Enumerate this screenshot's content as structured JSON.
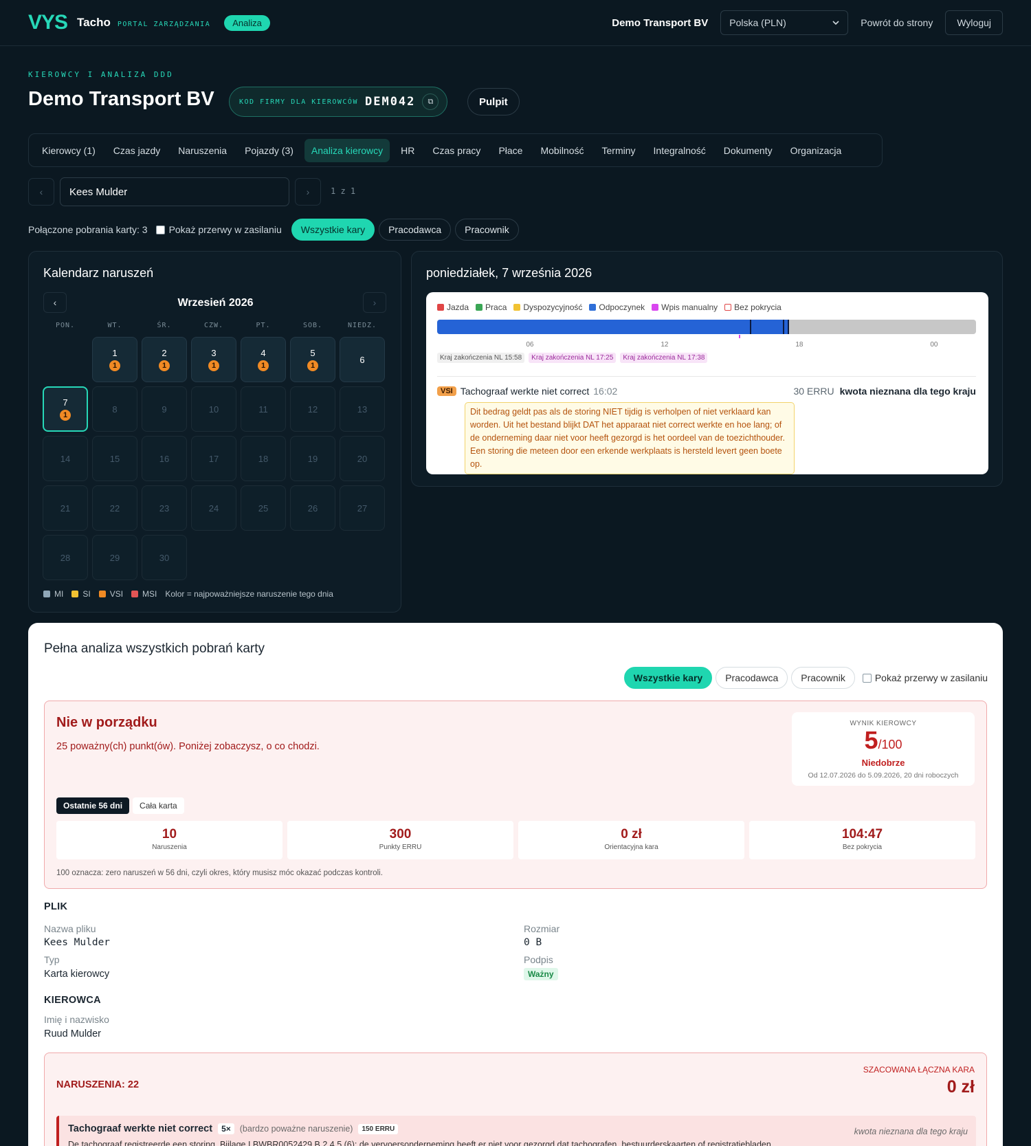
{
  "topbar": {
    "logo_mark": "VYS",
    "logo_name": "Tacho",
    "logo_sub": "PORTAL ZARZĄDZANIA",
    "badge": "Analiza",
    "company": "Demo Transport BV",
    "country_select": "Polska (PLN)",
    "back_link": "Powrót do strony",
    "logout": "Wyloguj"
  },
  "header": {
    "eyebrow": "KIEROWCY I ANALIZA DDD",
    "title": "Demo Transport BV",
    "code_label": "KOD FIRMY DLA KIEROWCÓW",
    "code_value": "DEM042",
    "pulpit": "Pulpit"
  },
  "tabs": [
    "Kierowcy (1)",
    "Czas jazdy",
    "Naruszenia",
    "Pojazdy (3)",
    "Analiza kierowcy",
    "HR",
    "Czas pracy",
    "Płace",
    "Mobilność",
    "Terminy",
    "Integralność",
    "Dokumenty",
    "Organizacja"
  ],
  "active_tab": "Analiza kierowcy",
  "driver": {
    "name": "Kees Mulder",
    "pager": "1 z 1",
    "prev": "‹",
    "next": "›"
  },
  "filters": {
    "downloads": "Połączone pobrania karty: 3",
    "power_breaks": "Pokaż przerwy w zasilaniu",
    "chips": [
      "Wszystkie kary",
      "Pracodawca",
      "Pracownik"
    ],
    "active_chip": "Wszystkie kary"
  },
  "calendar": {
    "title": "Kalendarz naruszeń",
    "month": "Wrzesień 2026",
    "weekdays": [
      "PON.",
      "WT.",
      "ŚR.",
      "CZW.",
      "PT.",
      "SOB.",
      "NIEDZ."
    ],
    "days": [
      {
        "d": "",
        "state": "empty"
      },
      {
        "d": "1",
        "state": "cur",
        "badge": "1"
      },
      {
        "d": "2",
        "state": "cur",
        "badge": "1"
      },
      {
        "d": "3",
        "state": "cur",
        "badge": "1"
      },
      {
        "d": "4",
        "state": "cur",
        "badge": "1"
      },
      {
        "d": "5",
        "state": "cur",
        "badge": "1"
      },
      {
        "d": "6",
        "state": "cur"
      },
      {
        "d": "7",
        "state": "sel",
        "badge": "1"
      },
      {
        "d": "8",
        "state": "fut"
      },
      {
        "d": "9",
        "state": "fut"
      },
      {
        "d": "10",
        "state": "fut"
      },
      {
        "d": "11",
        "state": "fut"
      },
      {
        "d": "12",
        "state": "fut"
      },
      {
        "d": "13",
        "state": "fut"
      },
      {
        "d": "14",
        "state": "fut"
      },
      {
        "d": "15",
        "state": "fut"
      },
      {
        "d": "16",
        "state": "fut"
      },
      {
        "d": "17",
        "state": "fut"
      },
      {
        "d": "18",
        "state": "fut"
      },
      {
        "d": "19",
        "state": "fut"
      },
      {
        "d": "20",
        "state": "fut"
      },
      {
        "d": "21",
        "state": "fut"
      },
      {
        "d": "22",
        "state": "fut"
      },
      {
        "d": "23",
        "state": "fut"
      },
      {
        "d": "24",
        "state": "fut"
      },
      {
        "d": "25",
        "state": "fut"
      },
      {
        "d": "26",
        "state": "fut"
      },
      {
        "d": "27",
        "state": "fut"
      },
      {
        "d": "28",
        "state": "fut"
      },
      {
        "d": "29",
        "state": "fut"
      },
      {
        "d": "30",
        "state": "fut"
      }
    ],
    "legend": [
      {
        "label": "MI",
        "color": "#8fa7b8"
      },
      {
        "label": "SI",
        "color": "#f1c232"
      },
      {
        "label": "VSI",
        "color": "#f08a24"
      },
      {
        "label": "MSI",
        "color": "#e25555"
      }
    ],
    "legend_note": "Kolor = najpoważniejsze naruszenie tego dnia"
  },
  "day_detail": {
    "title": "poniedziałek, 7 września 2026",
    "legend": [
      {
        "label": "Jazda",
        "color": "#e04646"
      },
      {
        "label": "Praca",
        "color": "#3aa655"
      },
      {
        "label": "Dyspozycyjność",
        "color": "#f1c232"
      },
      {
        "label": "Odpoczynek",
        "color": "#2f6fd8"
      },
      {
        "label": "Wpis manualny",
        "color": "#d946ef"
      },
      {
        "label": "Bez pokrycia",
        "color": "outline"
      }
    ],
    "timeline_rest_fraction": 0.653,
    "hours": [
      "06",
      "12",
      "18",
      "00"
    ],
    "tags": [
      {
        "text": "Kraj zakończenia NL 15:58",
        "kind": "g"
      },
      {
        "text": "Kraj zakończenia NL 17:25",
        "kind": "p"
      },
      {
        "text": "Kraj zakończenia NL 17:38",
        "kind": "p"
      }
    ],
    "violation": {
      "severity": "VSI",
      "title": "Tachograaf werkte niet correct",
      "time": "16:02",
      "points": "30 ERRU",
      "amount": "kwota nieznana dla tego kraju",
      "note": "Dit bedrag geldt pas als de storing NIET tijdig is verholpen of niet verklaard kan worden. Uit het bestand blijkt DAT het apparaat niet correct werkte en hoe lang; of de onderneming daar niet voor heeft gezorgd is het oordeel van de toezichthouder. Een storing die meteen door een erkende werkplaats is hersteld levert geen boete op."
    }
  },
  "full": {
    "title": "Pełna analiza wszystkich pobrań karty",
    "chips": [
      "Wszystkie kary",
      "Pracodawca",
      "Pracownik"
    ],
    "power_breaks": "Pokaż przerwy w zasilaniu",
    "status_title": "Nie w porządku",
    "status_sub": "25 poważny(ch) punkt(ów). Poniżej zobaczysz, o co chodzi.",
    "score": {
      "label": "WYNIK KIEROWCY",
      "value": "5",
      "of": "/100",
      "grade": "Niedobrze",
      "period": "Od 12.07.2026 do 5.09.2026, 20 dni roboczych"
    },
    "period_tabs": [
      "Ostatnie 56 dni",
      "Cała karta"
    ],
    "stats": [
      {
        "value": "10",
        "label": "Naruszenia"
      },
      {
        "value": "300",
        "label": "Punkty ERRU"
      },
      {
        "value": "0 zł",
        "label": "Orientacyjna kara"
      },
      {
        "value": "104:47",
        "label": "Bez pokrycia"
      }
    ],
    "stats_note": "100 oznacza: zero naruszeń w 56 dni, czyli okres, który musisz móc okazać podczas kontroli.",
    "file": {
      "heading": "PLIK",
      "name_label": "Nazwa pliku",
      "name_value": "Kees Mulder",
      "size_label": "Rozmiar",
      "size_value": "0 B",
      "type_label": "Typ",
      "type_value": "Karta kierowcy",
      "sig_label": "Podpis",
      "sig_value": "Ważny"
    },
    "driver": {
      "heading": "KIEROWCA",
      "name_label": "Imię i nazwisko",
      "name_value": "Ruud Mulder"
    },
    "violations": {
      "count": "NARUSZENIA: 22",
      "fine_label": "SZACOWANA ŁĄCZNA KARA",
      "fine_value": "0 zł",
      "item": {
        "title": "Tachograaf werkte niet correct",
        "times": "5×",
        "severity": "(bardzo poważne naruszenie)",
        "points": "150 ERRU",
        "amount": "kwota nieznana dla tego kraju",
        "desc": "De tachograaf registreerde een storing. Bijlage I BWBR0052429 B 2 4 5 (6): de vervoersonderneming heeft er niet voor gezorgd dat tachografen, bestuurderskaarten of registratiebladen"
      }
    }
  }
}
